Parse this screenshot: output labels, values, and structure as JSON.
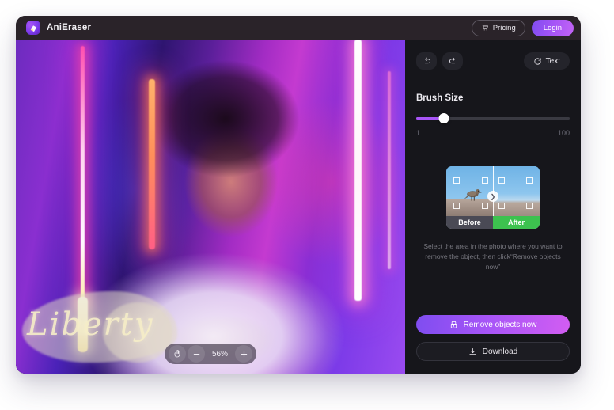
{
  "app": {
    "brand_name": "AniEraser",
    "logo_icon": "eraser-icon"
  },
  "titlebar": {
    "pricing_label": "Pricing",
    "pricing_icon": "cart-icon",
    "login_label": "Login"
  },
  "canvas": {
    "watermark_text": "Liberty",
    "zoom": {
      "pan_icon": "hand-icon",
      "zoom_out_label": "−",
      "zoom_out_icon": "minus-icon",
      "level": "56%",
      "zoom_in_label": "+",
      "zoom_in_icon": "plus-icon"
    }
  },
  "panel": {
    "undo_icon": "undo-icon",
    "redo_icon": "redo-icon",
    "text_button_label": "Text",
    "text_button_icon": "restore-circle-icon",
    "brush": {
      "label": "Brush Size",
      "value": 18,
      "min_label": "1",
      "max_label": "100"
    },
    "preview": {
      "before_label": "Before",
      "after_label": "After",
      "handle_icon": "chevron-right-icon",
      "subject_icon": "bird-icon"
    },
    "hint": "Select the area in the photo where you want to remove the object, then click“Remove objects now”",
    "remove_button_label": "Remove objects now",
    "remove_button_icon": "eraser-icon",
    "download_button_label": "Download",
    "download_button_icon": "download-icon"
  },
  "colors": {
    "accent": "#a855f7",
    "accent_gradient_start": "#7f4df0",
    "accent_gradient_end": "#d25df2",
    "after_tag": "#3dc24f",
    "panel_bg": "#16161b",
    "titlebar_bg": "#2a2329"
  }
}
